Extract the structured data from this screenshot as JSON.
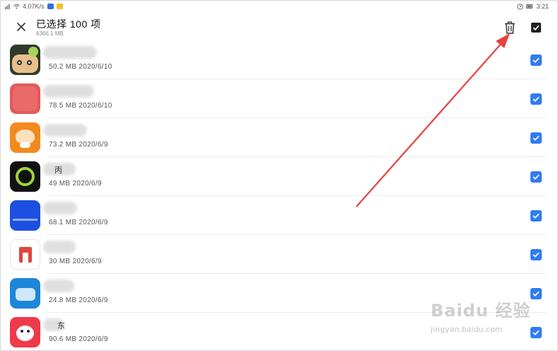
{
  "status_bar": {
    "speed": "4.07K/s",
    "time": "3:21"
  },
  "header": {
    "title": "已选择 100 项",
    "subtitle": "6366.1 MB"
  },
  "apps": [
    {
      "meta": "50.2 MB  2020/6/10",
      "name_fragment": "",
      "icon_color": "#2f3b2a",
      "checked": true
    },
    {
      "meta": "78.5 MB  2020/6/10",
      "name_fragment": "",
      "icon_color": "#e25a5a",
      "checked": true
    },
    {
      "meta": "73.2 MB  2020/6/9",
      "name_fragment": "",
      "icon_color": "#f28a1e",
      "checked": true
    },
    {
      "meta": "49 MB  2020/6/9",
      "name_fragment": "丙",
      "icon_color": "#111111",
      "checked": true
    },
    {
      "meta": "68.1 MB  2020/6/9",
      "name_fragment": "",
      "icon_color": "#1d4fe0",
      "checked": true
    },
    {
      "meta": "30 MB  2020/6/9",
      "name_fragment": "",
      "icon_color": "#ffffff",
      "checked": true
    },
    {
      "meta": "24.8 MB  2020/6/9",
      "name_fragment": "",
      "icon_color": "#1d86d6",
      "checked": true
    },
    {
      "meta": "90.6 MB  2020/6/9",
      "name_fragment": "东",
      "icon_color": "#ef3a4a",
      "checked": true
    }
  ],
  "watermark": {
    "logo": "Baidu 经验",
    "url": "jingyan.baidu.com"
  },
  "colors": {
    "accent": "#2f7bf5",
    "annotation": "#e84040"
  }
}
